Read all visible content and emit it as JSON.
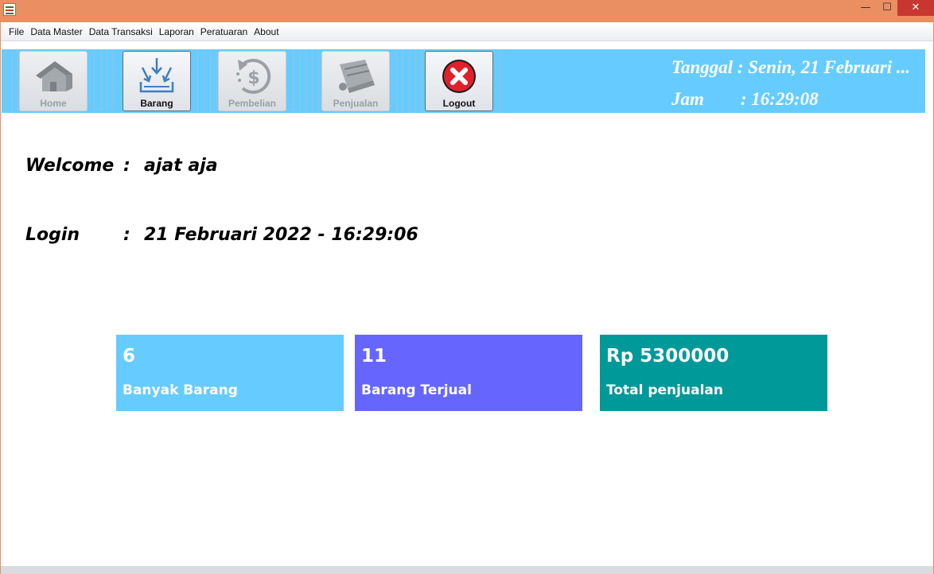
{
  "window": {
    "min_glyph": "—",
    "max_glyph": "☐",
    "close_glyph": "✕"
  },
  "menu": [
    "File",
    "Data Master",
    "Data Transaksi",
    "Laporan",
    "Peratuaran",
    "About"
  ],
  "toolbar": {
    "home_label": "Home",
    "barang_label": "Barang",
    "pembelian_label": "Pembelian",
    "penjualan_label": "Penjualan",
    "logout_label": "Logout",
    "date_text": "Tanggal : Senin, 21 Februari ...",
    "time_text": "Jam        : 16:29:08",
    "bg_color": "#66ccff"
  },
  "welcome": {
    "welcome_label": "Welcome",
    "welcome_sep": ":",
    "welcome_value": "ajat aja",
    "login_label": "Login",
    "login_sep": ":",
    "login_value": "21 Februari 2022 - 16:29:06"
  },
  "cards": [
    {
      "value": "6",
      "caption": "Banyak Barang",
      "color": "#66ccff"
    },
    {
      "value": "11",
      "caption": "Barang Terjual",
      "color": "#6666ff"
    },
    {
      "value": "Rp 5300000",
      "caption": "Total penjualan",
      "color": "#009999"
    }
  ]
}
